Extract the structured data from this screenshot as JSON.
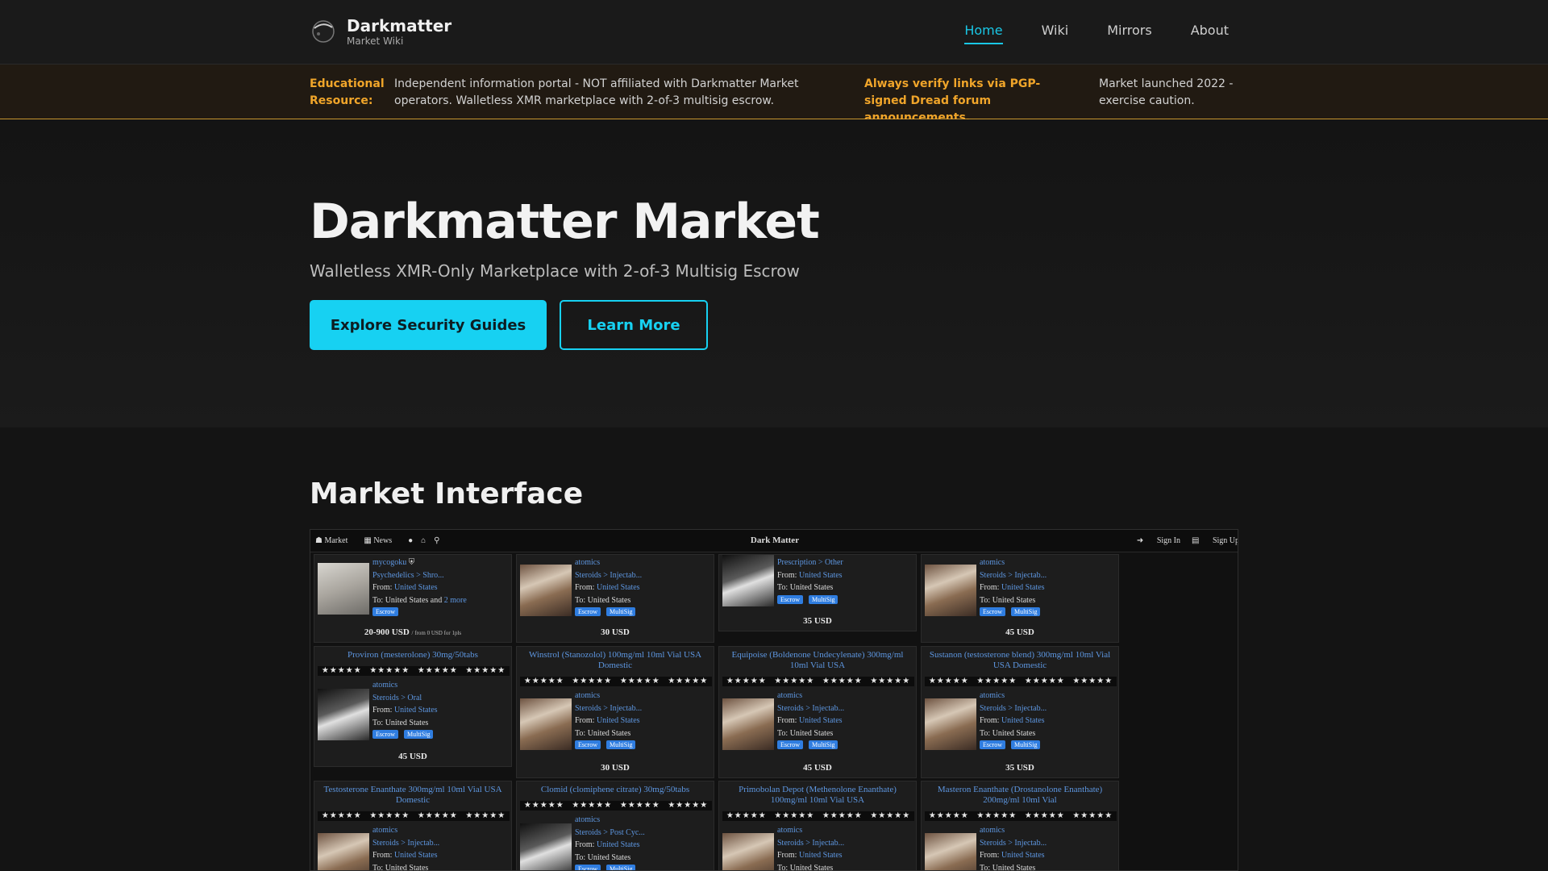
{
  "header": {
    "brand": "Darkmatter",
    "brand_sub": "Market Wiki",
    "nav": [
      "Home",
      "Wiki",
      "Mirrors",
      "About"
    ]
  },
  "banner": {
    "label": "Educational Resource:",
    "text": "Independent information portal - NOT affiliated with Darkmatter Market operators. Walletless XMR marketplace with 2-of-3 multisig escrow.",
    "warning": "Always verify links via PGP-signed Dread forum announcements.",
    "note": "Market launched 2022 - exercise caution."
  },
  "hero": {
    "title": "Darkmatter Market",
    "subtitle": "Walletless XMR-Only Marketplace with 2-of-3 Multisig Escrow",
    "primary_button": "Explore Security Guides",
    "secondary_button": "Learn More"
  },
  "section": {
    "title": "Market Interface"
  },
  "colors": {
    "accent": "#17d1f2",
    "warning": "#f0a52a",
    "link": "#5d96e0",
    "badge": "#2f7de0"
  },
  "screenshot": {
    "bar_left": [
      "Market",
      "News"
    ],
    "bar_center": "Dark Matter",
    "bar_right": [
      "Sign In",
      "Sign Up"
    ],
    "stars": "★★★★★",
    "escrow": "Escrow",
    "multisig": "MultiSig",
    "row1": [
      {
        "vendor": "mycogoku",
        "category": "Psychedelics > Shro...",
        "from_label": "From:",
        "from": "United States",
        "to": "To: United States and",
        "more": "2 more",
        "price": "20-900 USD",
        "price_note": "/ from 0 USD for 1pls"
      },
      {
        "vendor": "atomics",
        "category": "Steroids > Injectab...",
        "from_label": "From:",
        "from": "United States",
        "to": "To: United States",
        "price": "30 USD"
      },
      {
        "vendor": "atomics",
        "category": "Prescription > Other",
        "from_label": "From:",
        "from": "United States",
        "to": "To: United States",
        "price": "35 USD"
      },
      {
        "vendor": "atomics",
        "category": "Steroids > Injectab...",
        "from_label": "From:",
        "from": "United States",
        "to": "To: United States",
        "price": "45 USD"
      }
    ],
    "row2": [
      {
        "title": "Proviron (mesterolone) 30mg/50tabs",
        "vendor": "atomics",
        "category": "Steroids > Oral",
        "from_label": "From:",
        "from": "United States",
        "to": "To: United States",
        "price": "45 USD"
      },
      {
        "title": "Winstrol (Stanozolol) 100mg/ml 10ml Vial USA Domestic",
        "vendor": "atomics",
        "category": "Steroids > Injectab...",
        "from_label": "From:",
        "from": "United States",
        "to": "To: United States",
        "price": "30 USD"
      },
      {
        "title": "Equipoise (Boldenone Undecylenate) 300mg/ml 10ml Vial USA",
        "vendor": "atomics",
        "category": "Steroids > Injectab...",
        "from_label": "From:",
        "from": "United States",
        "to": "To: United States",
        "price": "45 USD"
      },
      {
        "title": "Sustanon (testosterone blend) 300mg/ml 10ml Vial USA Domestic",
        "vendor": "atomics",
        "category": "Steroids > Injectab...",
        "from_label": "From:",
        "from": "United States",
        "to": "To: United States",
        "price": "35 USD"
      }
    ],
    "row3": [
      {
        "title": "Testosterone Enanthate 300mg/ml 10ml Vial USA Domestic",
        "vendor": "atomics",
        "category": "Steroids > Injectab...",
        "from_label": "From:",
        "from": "United States",
        "to": "To: United States"
      },
      {
        "title": "Clomid (clomiphene citrate) 30mg/50tabs",
        "vendor": "atomics",
        "category": "Steroids > Post Cyc...",
        "from_label": "From:",
        "from": "United States",
        "to": "To: United States"
      },
      {
        "title": "Primobolan Depot (Methenolone Enanthate) 100mg/ml 10ml Vial USA",
        "vendor": "atomics",
        "category": "Steroids > Injectab...",
        "from_label": "From:",
        "from": "United States",
        "to": "To: United States"
      },
      {
        "title": "Masteron Enanthate (Drostanolone Enanthate) 200mg/ml 10ml Vial",
        "vendor": "atomics",
        "category": "Steroids > Injectab...",
        "from_label": "From:",
        "from": "United States",
        "to": "To: United States"
      }
    ]
  }
}
